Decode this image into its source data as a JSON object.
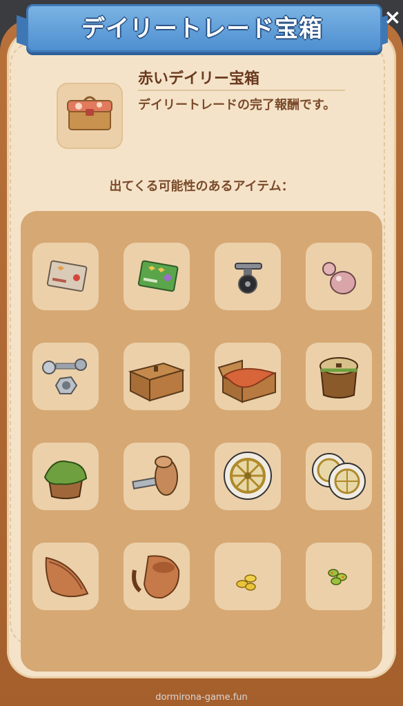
{
  "dialog": {
    "title": "デイリートレード宝箱",
    "close_label": "×"
  },
  "chest": {
    "name": "赤いデイリー宝箱",
    "description": "デイリートレードの完了報酬です。",
    "icon": "red-lunchbox-chest-icon"
  },
  "possible_items_label": "出てくる可能性のあるアイテム：",
  "items": [
    {
      "icon": "beige-card-icon"
    },
    {
      "icon": "green-card-icon"
    },
    {
      "icon": "caster-wheel-icon"
    },
    {
      "icon": "pink-knob-icon"
    },
    {
      "icon": "bolt-and-nut-icon"
    },
    {
      "icon": "closed-wooden-crate-icon"
    },
    {
      "icon": "open-crate-with-cloth-icon"
    },
    {
      "icon": "wooden-barrel-icon"
    },
    {
      "icon": "green-moss-stump-icon"
    },
    {
      "icon": "screw-plug-icon"
    },
    {
      "icon": "wagon-wheel-icon"
    },
    {
      "icon": "pair-of-wheels-icon"
    },
    {
      "icon": "clay-boat-shard-icon"
    },
    {
      "icon": "clay-pot-shard-icon"
    },
    {
      "icon": "gold-coins-icon"
    },
    {
      "icon": "green-seeds-icon"
    }
  ],
  "watermark": "dormirona-game.fun"
}
